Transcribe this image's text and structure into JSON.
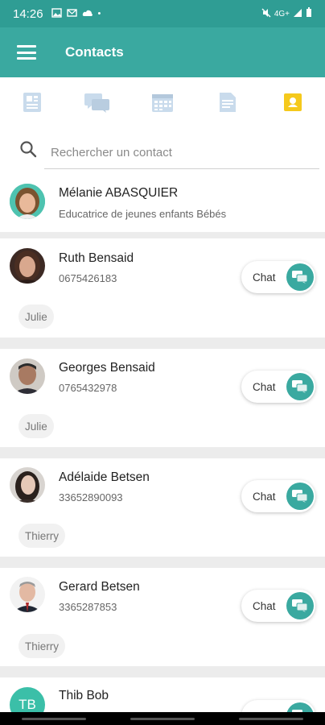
{
  "status_bar": {
    "time": "14:26",
    "signal": "4G+"
  },
  "app_bar": {
    "title": "Contacts"
  },
  "search": {
    "placeholder": "Rechercher un contact"
  },
  "contacts": [
    {
      "name": "Mélanie ABASQUIER",
      "subtitle": "Educatrice de jeunes enfants Bébés",
      "tag": "",
      "chat": ""
    },
    {
      "name": "Ruth Bensaid",
      "subtitle": "0675426183",
      "tag": "Julie",
      "chat": "Chat"
    },
    {
      "name": "Georges Bensaid",
      "subtitle": "0765432978",
      "tag": "Julie",
      "chat": "Chat"
    },
    {
      "name": "Adélaide Betsen",
      "subtitle": "33652890093",
      "tag": "Thierry",
      "chat": "Chat"
    },
    {
      "name": "Gerard Betsen",
      "subtitle": "3365287853",
      "tag": "Thierry",
      "chat": "Chat"
    },
    {
      "name": "Thib Bob",
      "subtitle": "",
      "tag": "",
      "chat": "",
      "initials": "TB"
    }
  ],
  "colors": {
    "primary": "#3aa9a0",
    "status_bar": "#2f9d94",
    "accent_yellow": "#f5c91c",
    "initials_bg": "#3bbfa8"
  }
}
